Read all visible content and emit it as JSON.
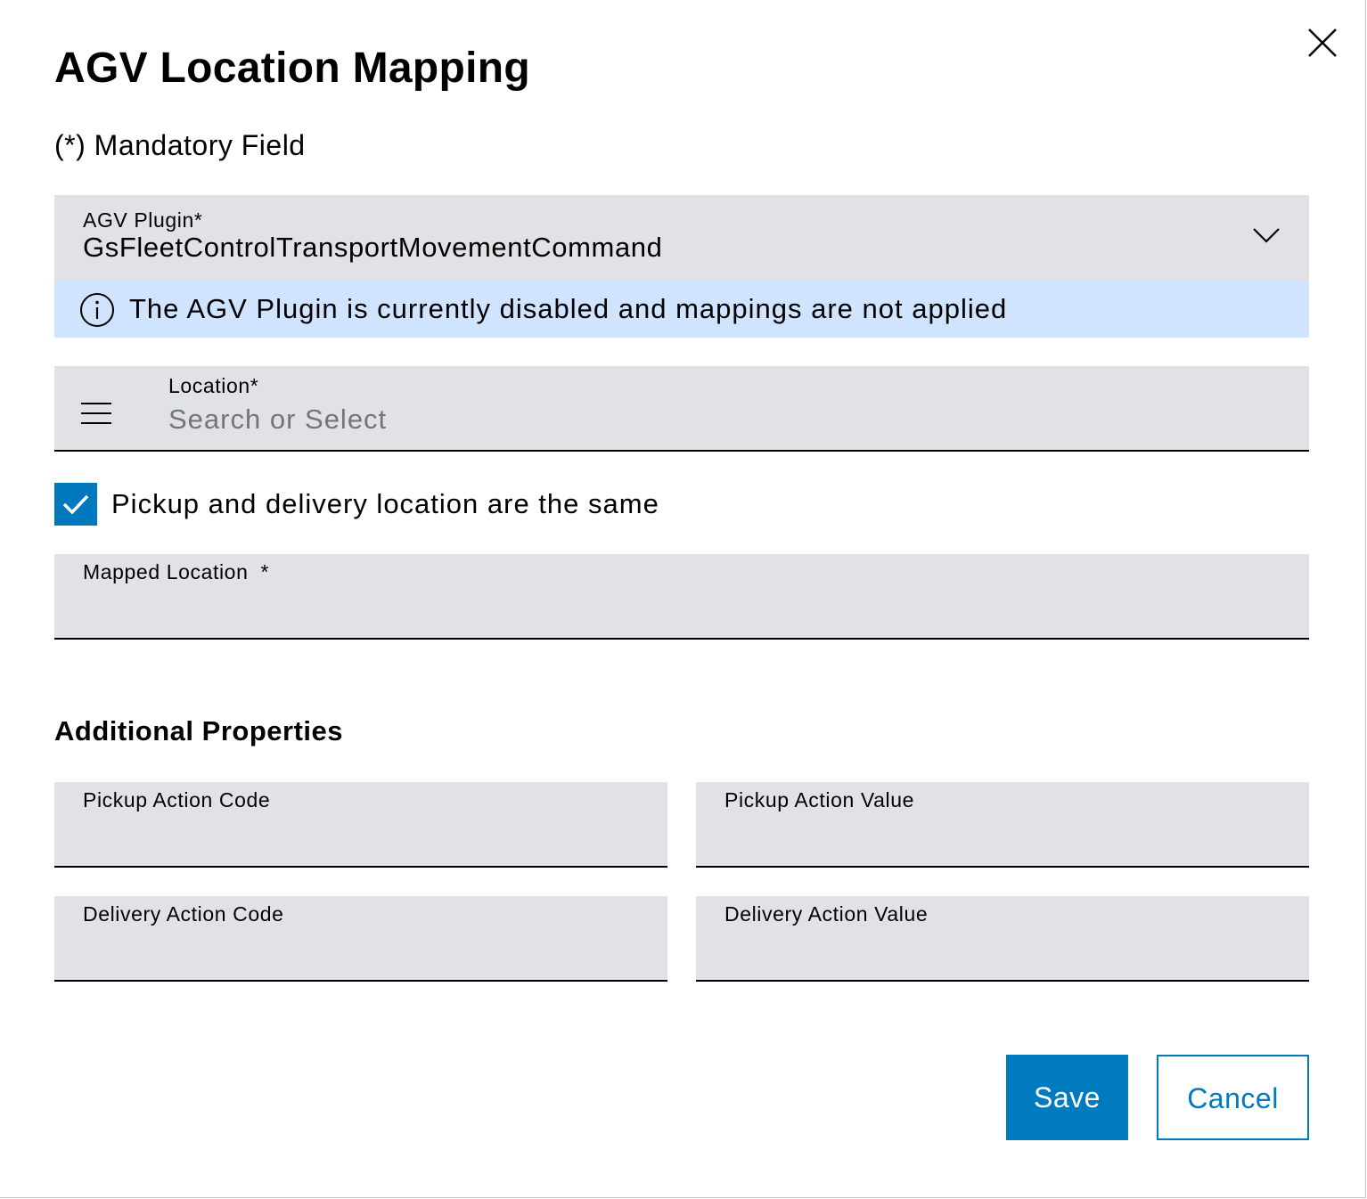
{
  "dialog": {
    "title": "AGV Location Mapping",
    "mandatory_note": "(*) Mandatory Field",
    "close_icon": "close-icon"
  },
  "plugin_field": {
    "label": "AGV Plugin*",
    "value": "GsFleetControlTransportMovementCommand",
    "icon": "chevron-down-icon"
  },
  "notice": {
    "icon": "info-icon",
    "text": "The AGV Plugin is currently disabled and mappings are not applied",
    "background": "#d1e4ff"
  },
  "location_field": {
    "label": "Location*",
    "placeholder": "Search or Select",
    "icon": "menu-icon"
  },
  "same_location_checkbox": {
    "label": "Pickup and delivery location are the same",
    "checked": true
  },
  "mapped_location_field": {
    "label": "Mapped Location  *"
  },
  "additional": {
    "title": "Additional Properties",
    "pickup_action_code_label": "Pickup Action Code",
    "pickup_action_value_label": "Pickup Action Value",
    "delivery_action_code_label": "Delivery Action Code",
    "delivery_action_value_label": "Delivery Action Value"
  },
  "actions": {
    "save_label": "Save",
    "cancel_label": "Cancel"
  },
  "colors": {
    "primary": "#007bc0",
    "field_background": "#e0e2e5",
    "info_background": "#d1e4ff"
  }
}
